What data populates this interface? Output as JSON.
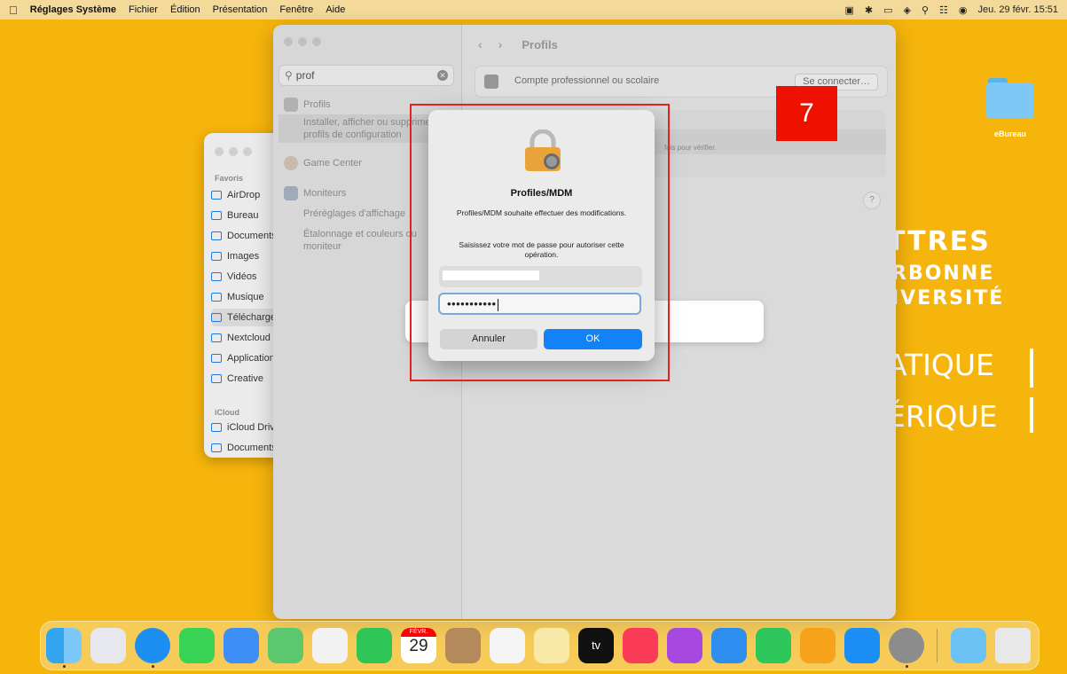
{
  "menubar": {
    "apple_icon": "apple-icon",
    "app_name": "Réglages Système",
    "menus": [
      "Fichier",
      "Édition",
      "Présentation",
      "Fenêtre",
      "Aide"
    ],
    "clock": "Jeu. 29 févr.  15:51"
  },
  "wallpaper": {
    "lines": [
      "TTRES",
      "RBONNE",
      "IVERSITÉ",
      "ATIQUE",
      "ÉRIQUE"
    ]
  },
  "desktop_folder": {
    "label": "eBureau"
  },
  "finder": {
    "section_favoris": "Favoris",
    "items": [
      "AirDrop",
      "Bureau",
      "Documents",
      "Images",
      "Vidéos",
      "Musique",
      "Téléchargements",
      "Nextcloud",
      "Applications",
      "Creative"
    ],
    "section_icloud": "iCloud",
    "icloud_items": [
      "iCloud Drive",
      "Documents"
    ]
  },
  "settings": {
    "search_value": "prof",
    "results": {
      "profils": "Profils",
      "profils_desc": "Installer, afficher ou supprimer des profils de configuration",
      "game_center": "Game Center",
      "moniteurs": "Moniteurs",
      "preglages": "Préréglages d'affichage",
      "etalonnage": "Étalonnage et couleurs du moniteur"
    },
    "page_title": "Profils",
    "account_row": "Compte professionnel ou scolaire",
    "connect_button": "Se connecter…",
    "verify_text": "fois pour vérifier.",
    "help": "?"
  },
  "dialog": {
    "title": "Profiles/MDM",
    "message": "Profiles/MDM souhaite effectuer des modifications.",
    "prompt": "Saisissez votre mot de passe pour autoriser cette opération.",
    "password_value": "•••••••••••",
    "cancel_label": "Annuler",
    "ok_label": "OK"
  },
  "annotation": {
    "step": "7"
  },
  "dock": {
    "calendar_month": "FÉVR.",
    "calendar_day": "29",
    "tv_label": "tv"
  },
  "colors": {
    "wallpaper": "#f6b50c",
    "ok_blue": "#1283f6",
    "annotation_red": "#ee1100"
  }
}
